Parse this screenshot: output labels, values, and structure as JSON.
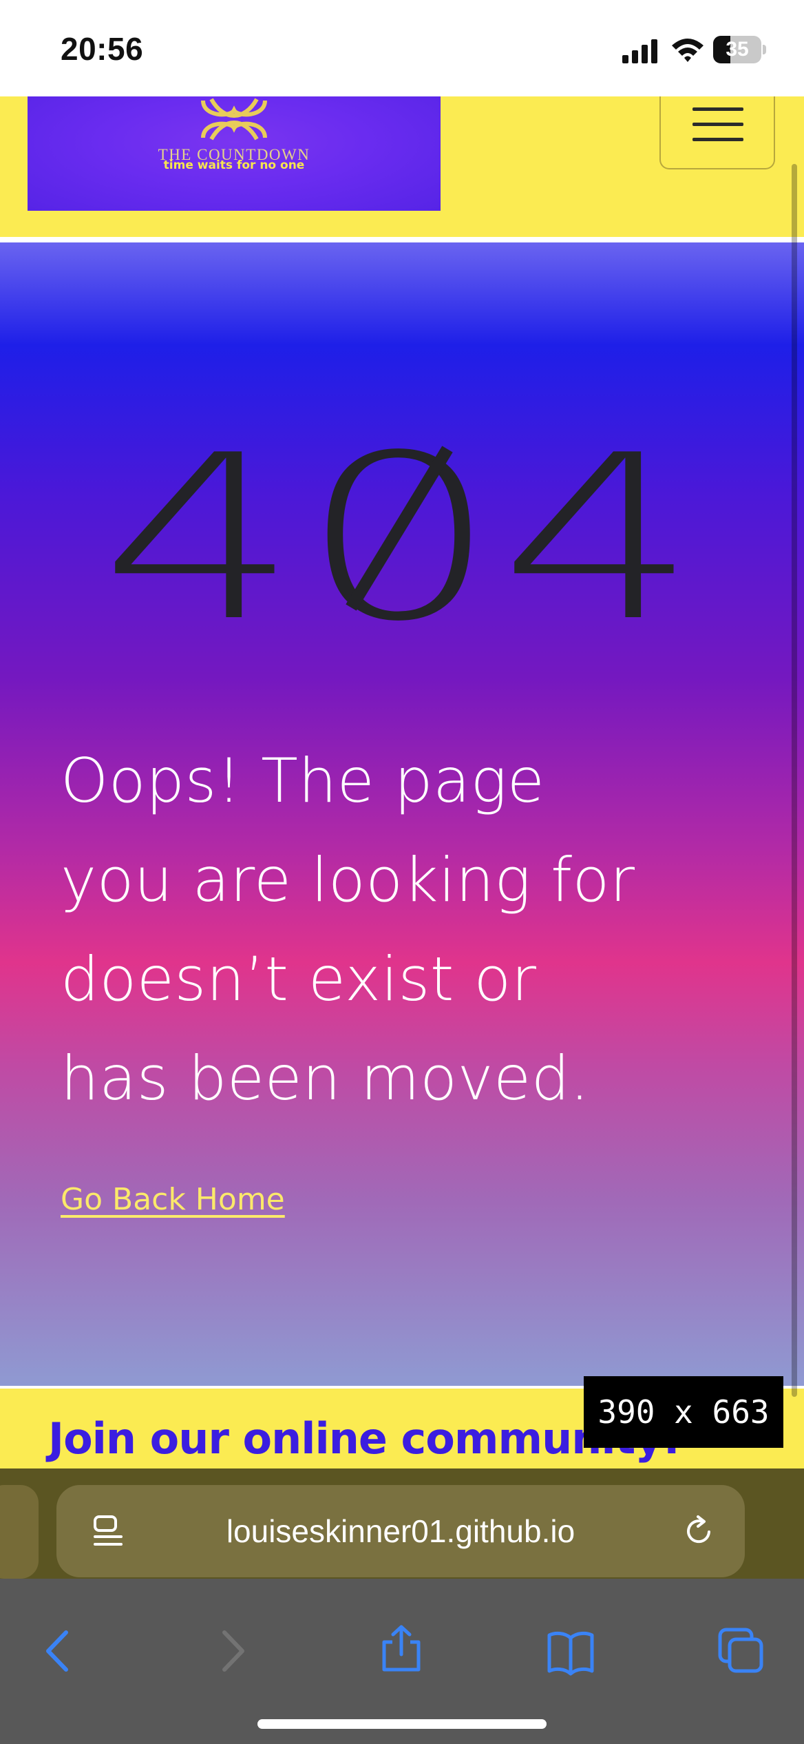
{
  "status_bar": {
    "time": "20:56",
    "battery_level": "35",
    "battery_fraction": 0.35,
    "signal_icon": "signal-bars-icon",
    "wifi_icon": "wifi-icon"
  },
  "header": {
    "logo_title": "THE COUNTDOWN",
    "logo_tagline": "time waits for no one",
    "logo_icon": "infinity-knot-logo",
    "menu_icon": "hamburger-menu-icon"
  },
  "hero": {
    "error_code": "404",
    "message_lines": [
      "Oops! The page",
      "you are looking for",
      "doesn’t exist or",
      "has been moved."
    ],
    "home_link": "Go Back Home"
  },
  "footer": {
    "heading": "Join our online community!"
  },
  "overlay": {
    "viewport_size": "390 x 663"
  },
  "browser": {
    "address": "louiseskinner01.github.io",
    "icons": [
      "reader-icon",
      "reload-icon",
      "back-icon",
      "forward-icon",
      "share-icon",
      "bookmarks-icon",
      "tabs-icon"
    ]
  },
  "colors": {
    "header_yellow": "#fbeb52",
    "logo_purple": "#6a2cf0",
    "footer_text": "#3b1ee0",
    "error_code_color": "#232327",
    "link_yellow": "#fbe96a",
    "safari_blue": "#3a83f6"
  }
}
